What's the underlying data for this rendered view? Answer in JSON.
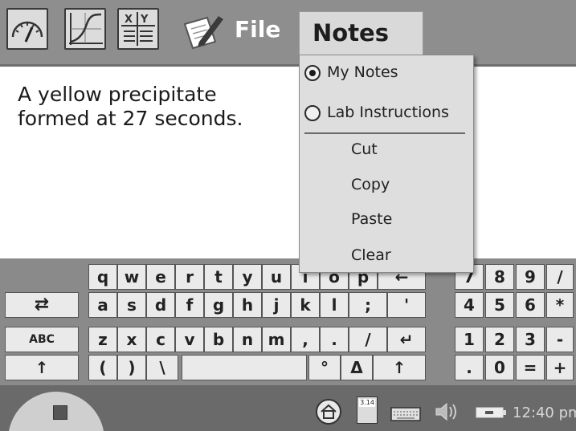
{
  "toolbar": {
    "icons": [
      "gauge-icon",
      "graph-icon",
      "table-icon",
      "pen-icon"
    ],
    "file_label": "File",
    "notes_label": "Notes"
  },
  "note": {
    "line1": "A yellow precipitate",
    "line2": "formed at 27 seconds."
  },
  "menu": {
    "radio_items": [
      {
        "label": "My Notes",
        "selected": true
      },
      {
        "label": "Lab Instructions",
        "selected": false
      }
    ],
    "items": [
      "Cut",
      "Copy",
      "Paste",
      "Clear"
    ]
  },
  "keyboard": {
    "row1": [
      "q",
      "w",
      "e",
      "r",
      "t",
      "y",
      "u",
      "i",
      "o",
      "p",
      "←"
    ],
    "row2": [
      "a",
      "s",
      "d",
      "f",
      "g",
      "h",
      "j",
      "k",
      "l",
      ";",
      "'"
    ],
    "row3": [
      "z",
      "x",
      "c",
      "v",
      "b",
      "n",
      "m",
      ",",
      ".",
      "/",
      "↵"
    ],
    "row4": [
      "(",
      ")",
      "\\",
      "",
      "°",
      "Δ",
      "↑"
    ],
    "side": [
      "⇄",
      "ABC",
      "↑"
    ],
    "numpad": [
      [
        "7",
        "8",
        "9",
        "/"
      ],
      [
        "4",
        "5",
        "6",
        "*"
      ],
      [
        "1",
        "2",
        "3",
        "-"
      ],
      [
        ".",
        "0",
        "=",
        "+"
      ]
    ]
  },
  "taskbar": {
    "tray_icons": [
      "home-icon",
      "calculator-icon",
      "keyboard-icon",
      "speaker-icon",
      "battery-icon"
    ],
    "calc_label": "3.14",
    "clock": "12:40 pm"
  },
  "colors": {
    "bar": "#8e8e8e",
    "menu": "#dedede",
    "keyboard": "#8a8a8a",
    "taskbar": "#6a6a6a"
  }
}
